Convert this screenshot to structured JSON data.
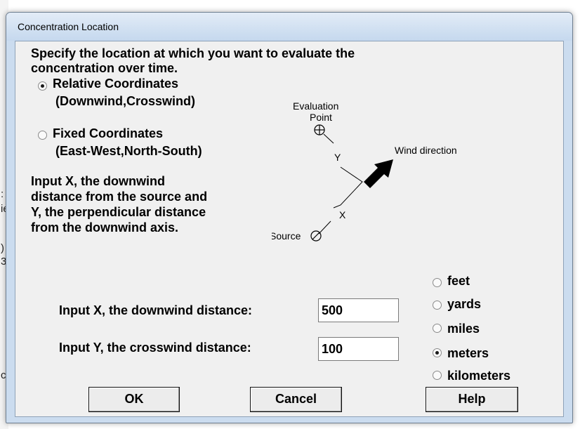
{
  "dialog": {
    "title": "Concentration Location",
    "instruction_line1": "Specify the location at which you want to evaluate the",
    "instruction_line2": "concentration over time.",
    "coord_options": [
      {
        "line1": "Relative Coordinates",
        "line2": "(Downwind,Crosswind)",
        "selected": true
      },
      {
        "line1": "Fixed Coordinates",
        "line2": "(East-West,North-South)",
        "selected": false
      }
    ],
    "description_lines": [
      "Input X, the downwind",
      "distance from the source and",
      "Y, the perpendicular distance",
      "from the downwind axis."
    ],
    "diagram": {
      "eval_label_1": "Evaluation",
      "eval_label_2": "Point",
      "y_label": "Y",
      "x_label": "X",
      "wind_label": "Wind direction",
      "source_label": "Source"
    },
    "input_x": {
      "label": "Input X, the downwind distance:",
      "value": "500"
    },
    "input_y": {
      "label": "Input Y, the crosswind distance:",
      "value": "100"
    },
    "units": [
      {
        "label": "feet",
        "selected": false
      },
      {
        "label": "yards",
        "selected": false
      },
      {
        "label": "miles",
        "selected": false
      },
      {
        "label": "meters",
        "selected": true
      },
      {
        "label": "kilometers",
        "selected": false
      }
    ],
    "buttons": {
      "ok": "OK",
      "cancel": "Cancel",
      "help": "Help"
    }
  },
  "background_window": {
    "glyphs": [
      ":",
      "ie",
      ")",
      "3",
      "c"
    ]
  }
}
